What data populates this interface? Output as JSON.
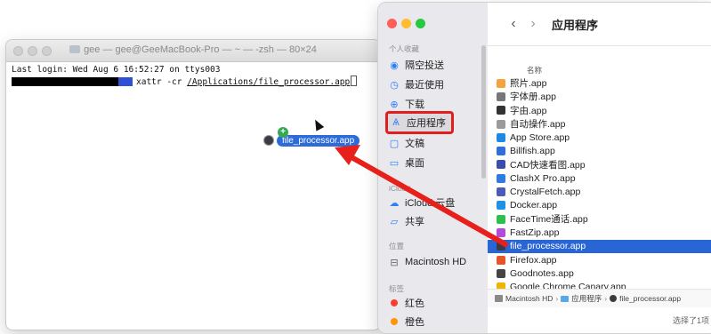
{
  "terminal": {
    "title": "gee — gee@GeeMacBook-Pro — ~ — -zsh — 80×24",
    "line1": "Last login: Wed Aug  6 16:52:27 on ttys003",
    "command": "xattr -cr ",
    "command_path": "/Applications/file_processor.app"
  },
  "drag": {
    "label": "file_processor.app",
    "badge": "+"
  },
  "finder": {
    "title": "应用程序",
    "sidebar": {
      "favorites_header": "个人收藏",
      "items": [
        {
          "label": "隔空投送",
          "icon": "airdrop-icon",
          "glyph": "◉"
        },
        {
          "label": "最近使用",
          "icon": "clock-icon",
          "glyph": "◷"
        },
        {
          "label": "下载",
          "icon": "download-icon",
          "glyph": "⊕"
        },
        {
          "label": "应用程序",
          "icon": "applications-icon",
          "glyph": "Ѧ"
        },
        {
          "label": "文稿",
          "icon": "document-icon",
          "glyph": "▢"
        },
        {
          "label": "桌面",
          "icon": "desktop-icon",
          "glyph": "▭"
        }
      ],
      "icloud_header": "iCloud",
      "icloud_items": [
        {
          "label": "iCloud 云盘",
          "icon": "cloud-icon",
          "glyph": "☁"
        },
        {
          "label": "共享",
          "icon": "shared-folder-icon",
          "glyph": "▱"
        }
      ],
      "locations_header": "位置",
      "locations_items": [
        {
          "label": "Macintosh HD",
          "icon": "disk-icon",
          "glyph": "⊟"
        }
      ],
      "tags_header": "标签",
      "tags": [
        {
          "label": "红色",
          "color": "#ff3b30"
        },
        {
          "label": "橙色",
          "color": "#ff9500"
        }
      ]
    },
    "column_header": "名称",
    "files": [
      {
        "name": "照片.app",
        "color": "#f4a340"
      },
      {
        "name": "字体册.app",
        "color": "#777777"
      },
      {
        "name": "字由.app",
        "color": "#333333"
      },
      {
        "name": "自动操作.app",
        "color": "#9a9a9a"
      },
      {
        "name": "App Store.app",
        "color": "#1e88e5"
      },
      {
        "name": "Billfish.app",
        "color": "#2f6fdc"
      },
      {
        "name": "CAD快速看图.app",
        "color": "#3a4ea8"
      },
      {
        "name": "ClashX Pro.app",
        "color": "#2f7be0"
      },
      {
        "name": "CrystalFetch.app",
        "color": "#4b5bb6"
      },
      {
        "name": "Docker.app",
        "color": "#1d91e6"
      },
      {
        "name": "FaceTime通话.app",
        "color": "#2fbf4f"
      },
      {
        "name": "FastZip.app",
        "color": "#b44ad9"
      },
      {
        "name": "file_processor.app",
        "color": "#3b3b46",
        "selected": true
      },
      {
        "name": "Firefox.app",
        "color": "#e5542b"
      },
      {
        "name": "Goodnotes.app",
        "color": "#444444"
      },
      {
        "name": "Google Chrome Canary.app",
        "color": "#f0b400"
      }
    ],
    "pathbar": {
      "disk": "Macintosh HD",
      "folder": "应用程序",
      "file": "file_processor.app",
      "sep": "›"
    },
    "status": "选择了1项"
  },
  "colors": {
    "highlight_red": "#e02020",
    "selection_blue": "#2a65d6",
    "arrow_red": "#e8201c"
  }
}
